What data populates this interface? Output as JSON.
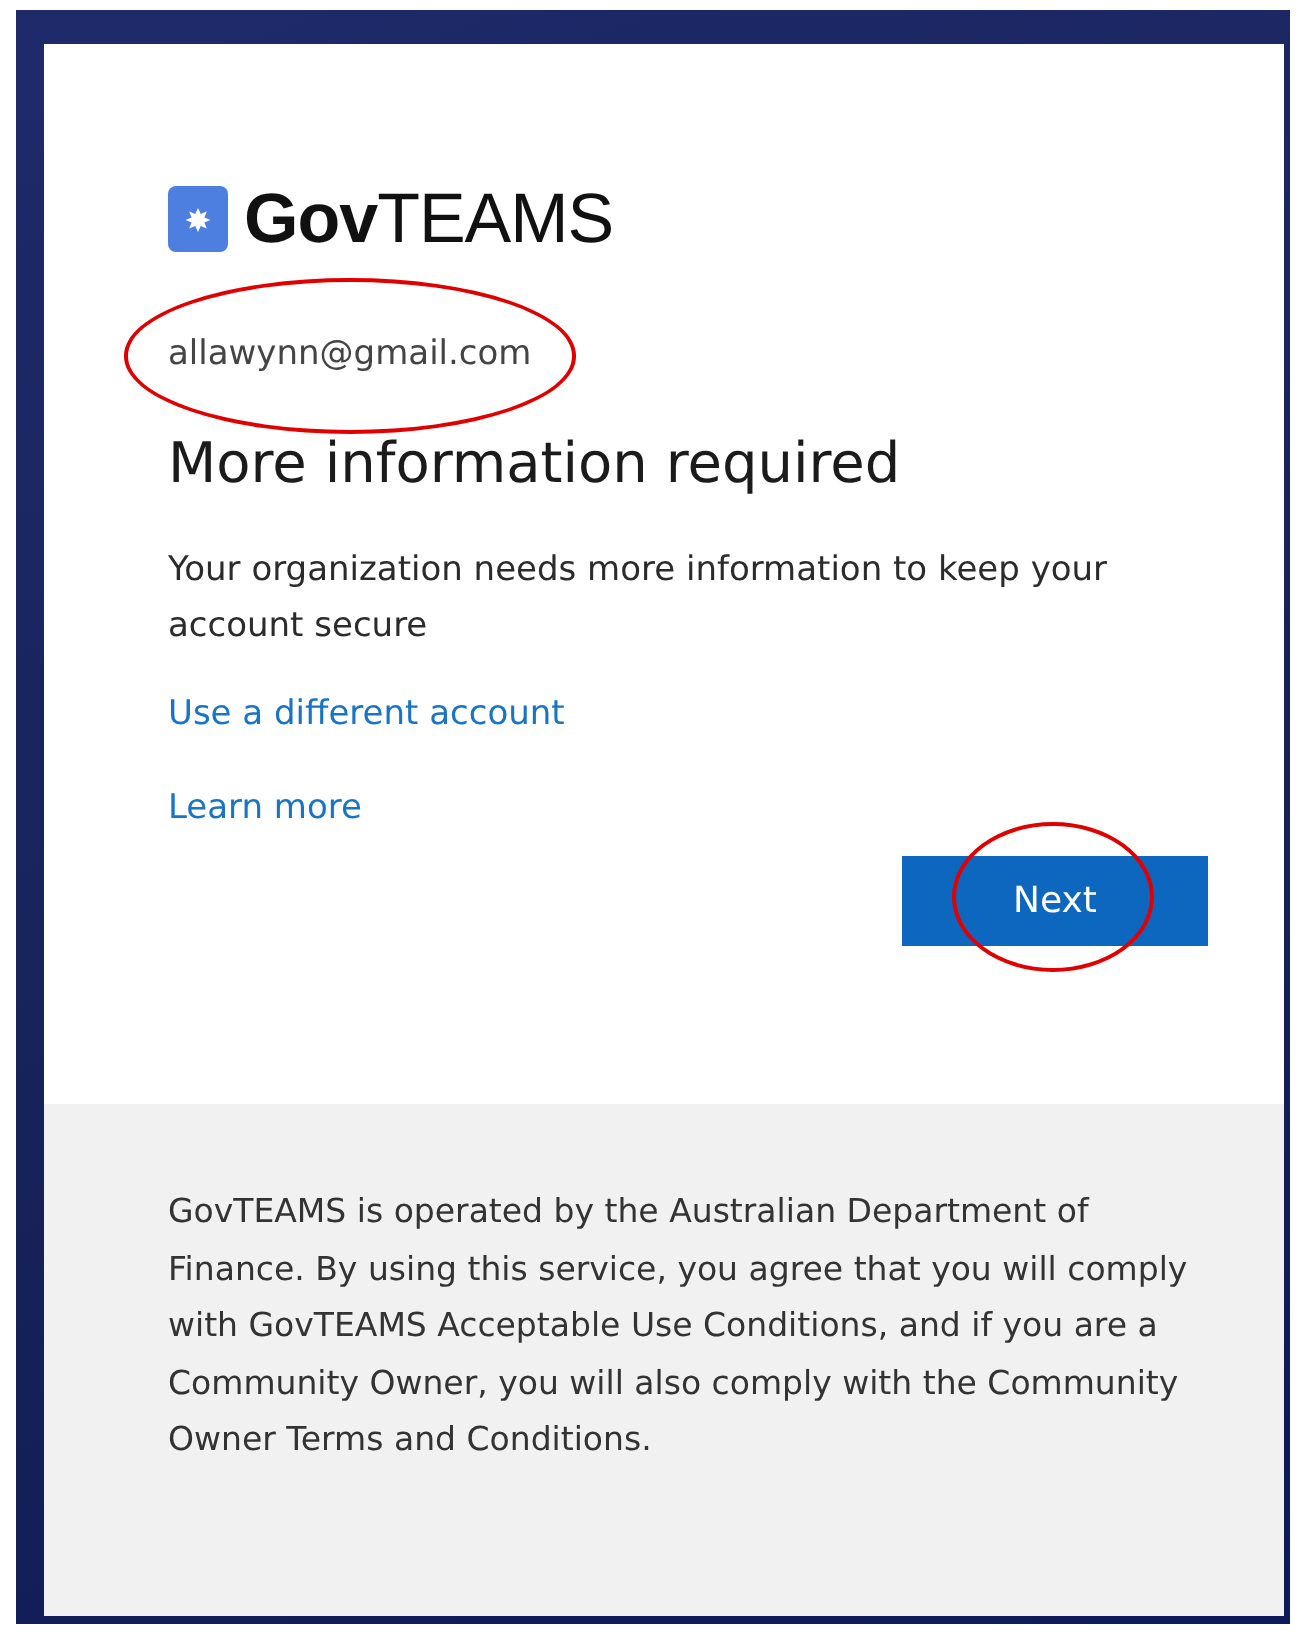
{
  "brand": {
    "name": "**Gov**TEAMS"
  },
  "account": {
    "email": "allawynn@gmail.com",
    "circled": true
  },
  "heading": "More information required",
  "message": "Your organization needs more information to keep your account secure",
  "links": [
    "Use a different account",
    "Learn more"
  ],
  "next_button": {
    "label": "Next",
    "circled": true
  },
  "footer": "GovTEAMS is operated by the Australian Department of Finance. By using this service, you agree that you will comply with GovTEAMS Acceptable Use Conditions, and if you are a Community Owner, you will also comply with the Community Owner Terms and Conditions."
}
